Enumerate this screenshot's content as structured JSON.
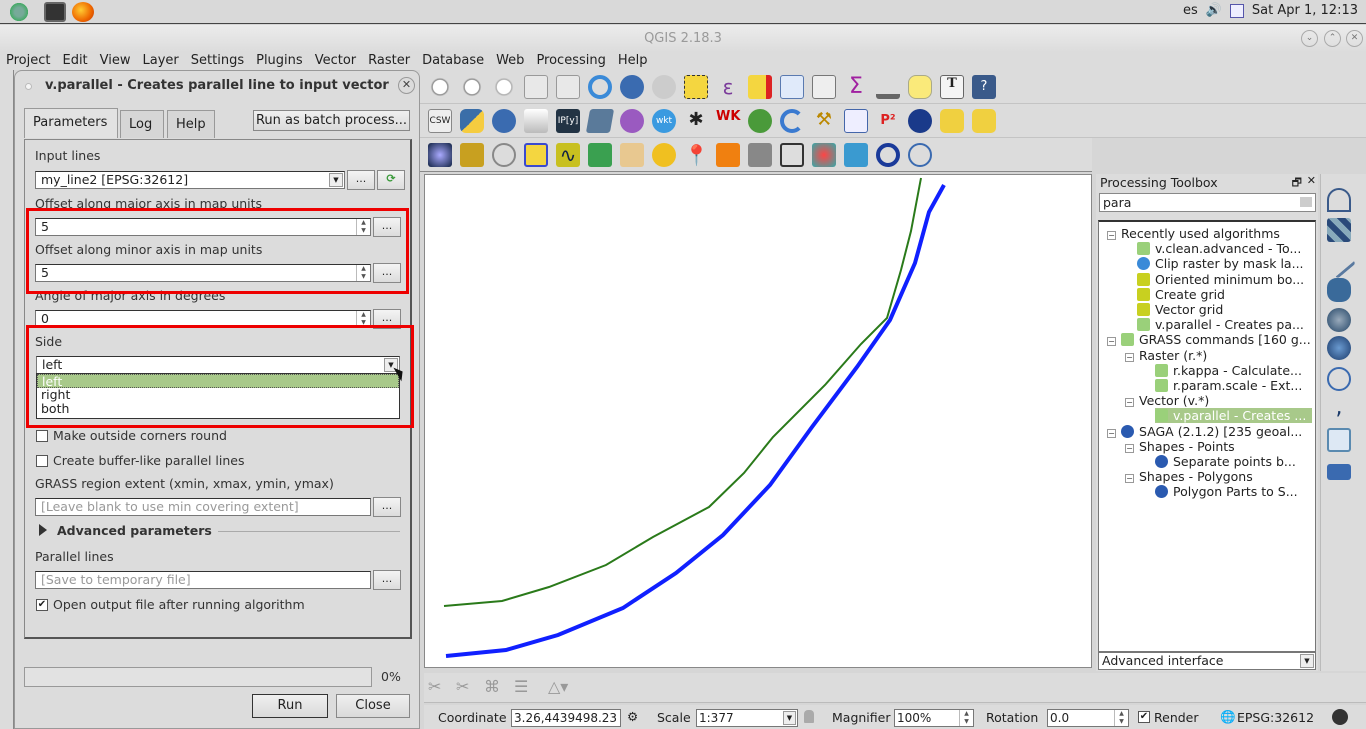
{
  "system_bar": {
    "lang": "es",
    "datetime": "Sat Apr  1, 12:13"
  },
  "window": {
    "title": "QGIS 2.18.3"
  },
  "menu": [
    "Project",
    "Edit",
    "View",
    "Layer",
    "Settings",
    "Plugins",
    "Vector",
    "Raster",
    "Database",
    "Web",
    "Processing",
    "Help"
  ],
  "dialog": {
    "title": "v.parallel - Creates parallel line to input vector",
    "tabs": [
      "Parameters",
      "Log",
      "Help"
    ],
    "batch_button": "Run as batch process...",
    "input_lines_label": "Input lines",
    "input_lines_value": "my_line2 [EPSG:32612]",
    "offset_major_label": "Offset along major axis in map units",
    "offset_major_value": "5",
    "offset_minor_label": "Offset along minor axis in map units",
    "offset_minor_value": "5",
    "angle_label": "Angle of major axis in degrees",
    "angle_value": "0",
    "side_label": "Side",
    "side_value": "left",
    "side_options": [
      "left",
      "right",
      "both"
    ],
    "round_corners_label": "Make outside corners round",
    "round_corners_checked": false,
    "buffer_like_label": "Create buffer-like parallel lines",
    "buffer_like_checked": false,
    "region_label": "GRASS region extent (xmin, xmax, ymin, ymax)",
    "region_placeholder": "[Leave blank to use min covering extent]",
    "advanced_label": "Advanced parameters",
    "output_label": "Parallel lines",
    "output_placeholder": "[Save to temporary file]",
    "open_output_label": "Open output file after running algorithm",
    "open_output_checked": true,
    "progress_text": "0%",
    "progress_value": 0,
    "run_button": "Run",
    "close_button": "Close",
    "more_button": "...",
    "close_icon": "✕"
  },
  "toolbox": {
    "title": "Processing Toolbox",
    "search_value": "para",
    "tree": [
      {
        "label": "Recently used algorithms",
        "level": 0,
        "expander": "⊟"
      },
      {
        "label": "v.clean.advanced - To...",
        "level": 1,
        "icon": "grass"
      },
      {
        "label": "Clip raster by mask la...",
        "level": 1,
        "icon": "gdal"
      },
      {
        "label": "Oriented minimum bo...",
        "level": 1,
        "icon": "qgis"
      },
      {
        "label": "Create grid",
        "level": 1,
        "icon": "qgis"
      },
      {
        "label": "Vector grid",
        "level": 1,
        "icon": "qgis"
      },
      {
        "label": "v.parallel - Creates pa...",
        "level": 1,
        "icon": "grass"
      },
      {
        "label": "GRASS commands [160 g...",
        "level": 0,
        "icon": "grass",
        "expander": "⊟"
      },
      {
        "label": "Raster (r.*)",
        "level": 1,
        "expander": "⊟"
      },
      {
        "label": "r.kappa - Calculate...",
        "level": 2,
        "icon": "grass"
      },
      {
        "label": "r.param.scale - Ext...",
        "level": 2,
        "icon": "grass"
      },
      {
        "label": "Vector (v.*)",
        "level": 1,
        "expander": "⊟"
      },
      {
        "label": "v.parallel - Creates ...",
        "level": 2,
        "icon": "grass",
        "selected": true
      },
      {
        "label": "SAGA (2.1.2) [235 geoal...",
        "level": 0,
        "icon": "saga",
        "expander": "⊟"
      },
      {
        "label": "Shapes - Points",
        "level": 1,
        "expander": "⊟"
      },
      {
        "label": "Separate points b...",
        "level": 2,
        "icon": "saga"
      },
      {
        "label": "Shapes - Polygons",
        "level": 1,
        "expander": "⊟"
      },
      {
        "label": "Polygon Parts to S...",
        "level": 2,
        "icon": "saga"
      }
    ],
    "interface_select": "Advanced interface"
  },
  "statusbar": {
    "coordinate_label": "Coordinate",
    "coordinate_value": "3.26,4439498.23",
    "scale_label": "Scale",
    "scale_value": "1:377",
    "magnifier_label": "Magnifier",
    "magnifier_value": "100%",
    "rotation_label": "Rotation",
    "rotation_value": "0.0",
    "render_label": "Render",
    "render_checked": true,
    "crs": "EPSG:32612"
  },
  "colors": {
    "accent_selection": "#a8c98a",
    "highlight_box": "#e00000",
    "line_input": "#1020ff",
    "line_output": "#2a7a1a"
  }
}
